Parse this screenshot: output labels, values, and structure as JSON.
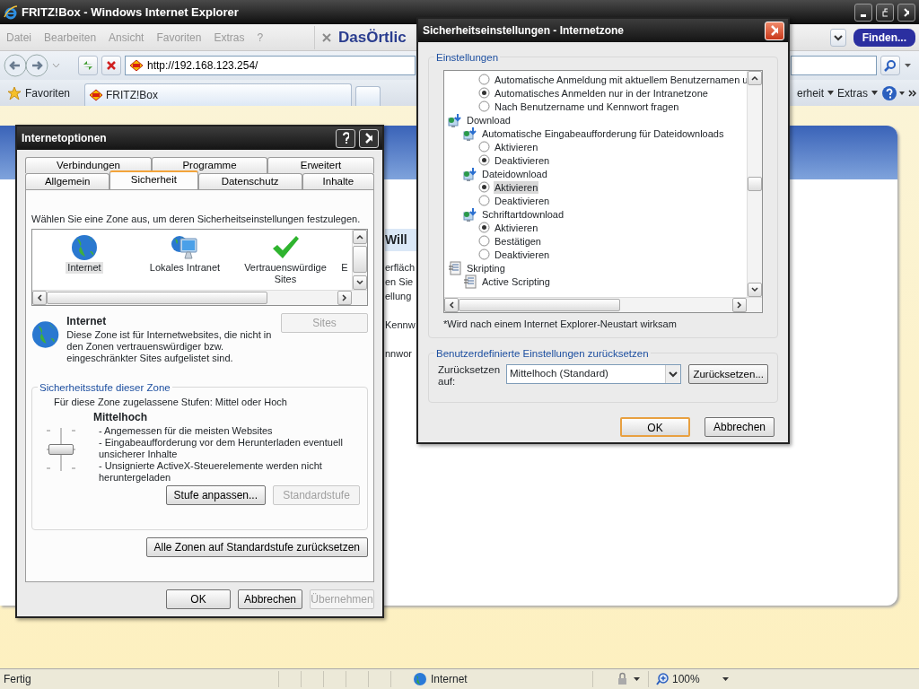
{
  "browser": {
    "title": "FRITZ!Box - Windows Internet Explorer",
    "menu": [
      "Datei",
      "Bearbeiten",
      "Ansicht",
      "Favoriten",
      "Extras",
      "?"
    ],
    "toolbar_brand": "DasÖrtlic",
    "find_button": "Finden...",
    "address": "http://192.168.123.254/",
    "favorites": "Favoriten",
    "tab": "FRITZ!Box",
    "commands": [
      "erheit",
      "Extras"
    ]
  },
  "page": {
    "fragments": [
      {
        "kind": "heading",
        "text": "Will"
      },
      {
        "kind": "text",
        "text": "erfläch"
      },
      {
        "kind": "text",
        "text": "en Sie"
      },
      {
        "kind": "text",
        "text": "ellung"
      },
      {
        "kind": "label",
        "text": "Kennw"
      },
      {
        "kind": "label",
        "text": "nnwor"
      }
    ]
  },
  "internet_options": {
    "title": "Internetoptionen",
    "tab_rows": [
      [
        {
          "label": "Verbindungen",
          "selected": false
        },
        {
          "label": "Programme",
          "selected": false
        },
        {
          "label": "Erweitert",
          "selected": false
        }
      ],
      [
        {
          "label": "Allgemein",
          "selected": false
        },
        {
          "label": "Sicherheit",
          "selected": true
        },
        {
          "label": "Datenschutz",
          "selected": false
        },
        {
          "label": "Inhalte",
          "selected": false
        }
      ]
    ],
    "prompt": "Wählen Sie eine Zone aus, um deren Sicherheitseinstellungen festzulegen.",
    "zones": [
      {
        "kind": "internet",
        "label": "Internet",
        "selected": true
      },
      {
        "kind": "intranet",
        "label": "Lokales Intranet",
        "selected": false
      },
      {
        "kind": "trusted",
        "label": "Vertrauenswürdige Sites",
        "selected": false
      },
      {
        "kind": "restricted",
        "label": "E",
        "selected": false
      }
    ],
    "zone_name": "Internet",
    "zone_description": "Diese Zone ist für Internetwebsites, die nicht in den Zonen vertrauenswürdiger bzw. eingeschränkter Sites aufgelistet sind.",
    "sites_button": {
      "label": "Sites",
      "disabled": true
    },
    "level_group": {
      "title": "Sicherheitsstufe dieser Zone",
      "allowed": "Für diese Zone zugelassene Stufen: Mittel oder Hoch",
      "level_name": "Mittelhoch",
      "slider": {
        "level": 0.5
      },
      "details": [
        "- Angemessen für die meisten Websites",
        "- Eingabeaufforderung vor dem Herunterladen eventuell unsicherer Inhalte",
        "- Unsignierte ActiveX-Steuerelemente werden nicht heruntergeladen"
      ],
      "buttons": [
        {
          "label": "Stufe anpassen...",
          "disabled": false
        },
        {
          "label": "Standardstufe",
          "disabled": true
        }
      ]
    },
    "reset_all_button": "Alle Zonen auf Standardstufe zurücksetzen",
    "buttons": [
      {
        "label": "OK",
        "disabled": false
      },
      {
        "label": "Abbrechen",
        "disabled": false
      },
      {
        "label": "Übernehmen",
        "disabled": true
      }
    ]
  },
  "security_settings": {
    "title": "Sicherheitseinstellungen - Internetzone",
    "settings_group": "Einstellungen",
    "tree": [
      {
        "kind": "option",
        "label": "Automatische Anmeldung mit aktuellem Benutzernamen u",
        "checked": false,
        "selected": false
      },
      {
        "kind": "option",
        "label": "Automatisches Anmelden nur in der Intranetzone",
        "checked": true,
        "selected": false
      },
      {
        "kind": "option",
        "label": "Nach Benutzername und Kennwort fragen",
        "checked": false,
        "selected": false
      },
      {
        "kind": "download-setting",
        "label": "Download",
        "children": [
          {
            "kind": "download-setting",
            "label": "Automatische Eingabeaufforderung für Dateidownloads",
            "children": [
              {
                "kind": "option",
                "label": "Aktivieren",
                "checked": false,
                "selected": false
              },
              {
                "kind": "option",
                "label": "Deaktivieren",
                "checked": true,
                "selected": false
              }
            ]
          },
          {
            "kind": "download-setting",
            "label": "Dateidownload",
            "children": [
              {
                "kind": "option",
                "label": "Aktivieren",
                "checked": true,
                "selected": true
              },
              {
                "kind": "option",
                "label": "Deaktivieren",
                "checked": false,
                "selected": false
              }
            ]
          },
          {
            "kind": "download-setting",
            "label": "Schriftartdownload",
            "children": [
              {
                "kind": "option",
                "label": "Aktivieren",
                "checked": true,
                "selected": false
              },
              {
                "kind": "option",
                "label": "Bestätigen",
                "checked": false,
                "selected": false
              },
              {
                "kind": "option",
                "label": "Deaktivieren",
                "checked": false,
                "selected": false
              }
            ]
          }
        ]
      },
      {
        "kind": "script-setting",
        "label": "Skripting",
        "children": [
          {
            "kind": "script-setting",
            "label": "Active Scripting"
          }
        ]
      }
    ],
    "note": "*Wird nach einem Internet Explorer-Neustart wirksam",
    "reset_group": "Benutzerdefinierte Einstellungen zurücksetzen",
    "reset_label": "Zurücksetzen auf:",
    "reset_value": "Mittelhoch (Standard)",
    "reset_button": "Zurücksetzen...",
    "buttons": [
      {
        "label": "OK",
        "default": true
      },
      {
        "label": "Abbrechen",
        "default": false
      }
    ]
  },
  "status_bar": {
    "text": "Fertig",
    "zone": "Internet",
    "zoom": "100%"
  }
}
